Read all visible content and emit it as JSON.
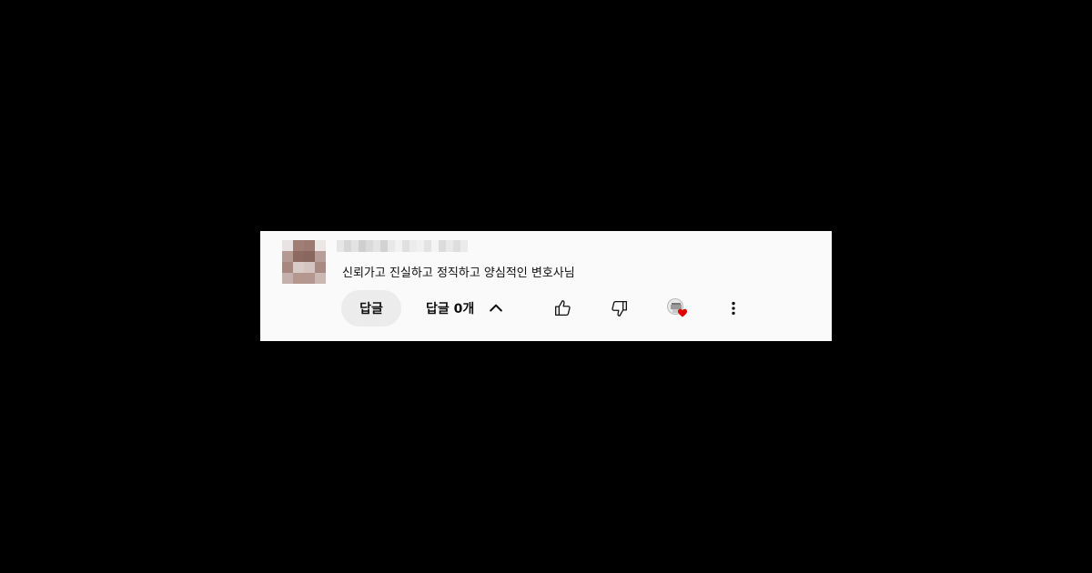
{
  "comment": {
    "author_redacted": true,
    "text": "신뢰가고 진실하고 정직하고 양심적인 변호사님",
    "actions": {
      "reply_label": "답글",
      "replies_toggle_label": "답글 0개",
      "like_icon": "thumb-up-icon",
      "dislike_icon": "thumb-down-icon",
      "creator_heart_icon": "creator-heart-icon",
      "more_icon": "more-vert-icon"
    }
  },
  "colors": {
    "page_background": "#000000",
    "card_background": "#fafafa",
    "text": "#0f0f0f",
    "reply_button_bg": "#ececec",
    "heart": "#e00000"
  }
}
